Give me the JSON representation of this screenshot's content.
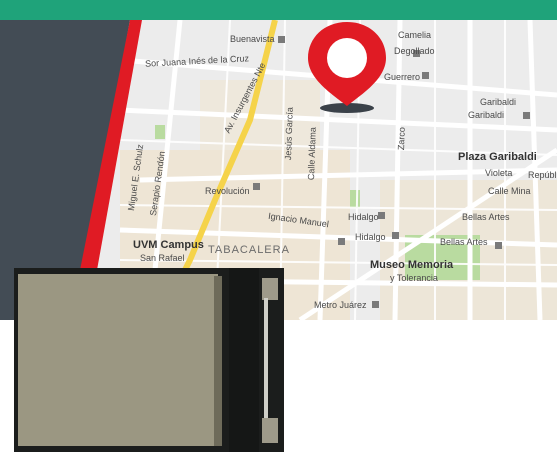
{
  "colors": {
    "top_bar": "#1fa37a",
    "dark_panel": "#434c55",
    "red_stripe": "#e01b24",
    "pin": "#e01b24",
    "map_bg": "#ececec"
  },
  "map": {
    "labels": [
      {
        "id": "buenavista",
        "text": "Buenavista",
        "cls": ""
      },
      {
        "id": "camelia",
        "text": "Camelia",
        "cls": ""
      },
      {
        "id": "degollado",
        "text": "Degollado",
        "cls": ""
      },
      {
        "id": "guerrero",
        "text": "Guerrero",
        "cls": ""
      },
      {
        "id": "sor-juana",
        "text": "Sor Juana Inés de la Cruz",
        "cls": ""
      },
      {
        "id": "av-insurgentes",
        "text": "Av. Insurgentes Nte",
        "cls": ""
      },
      {
        "id": "jesus-garcia",
        "text": "Jesús García",
        "cls": ""
      },
      {
        "id": "calle-aldama",
        "text": "Calle Aldama",
        "cls": ""
      },
      {
        "id": "zarco",
        "text": "Zarco",
        "cls": ""
      },
      {
        "id": "garibaldi-1",
        "text": "Garibaldi",
        "cls": ""
      },
      {
        "id": "garibaldi-2",
        "text": "Garibaldi",
        "cls": ""
      },
      {
        "id": "plaza-garibaldi",
        "text": "Plaza Garibaldi",
        "cls": "big"
      },
      {
        "id": "violeta",
        "text": "Violeta",
        "cls": ""
      },
      {
        "id": "republica",
        "text": "Repúbl",
        "cls": ""
      },
      {
        "id": "calle-mina",
        "text": "Calle Mina",
        "cls": ""
      },
      {
        "id": "revolucion",
        "text": "Revolución",
        "cls": ""
      },
      {
        "id": "ignacio-manuel",
        "text": "Ignacio Manuel",
        "cls": ""
      },
      {
        "id": "hidalgo-1",
        "text": "Hidalgo",
        "cls": ""
      },
      {
        "id": "hidalgo-2",
        "text": "Hidalgo",
        "cls": ""
      },
      {
        "id": "bellas-artes-1",
        "text": "Bellas Artes",
        "cls": ""
      },
      {
        "id": "bellas-artes-2",
        "text": "Bellas Artes",
        "cls": ""
      },
      {
        "id": "uvm-campus",
        "text": "UVM Campus",
        "cls": "big"
      },
      {
        "id": "san-rafael",
        "text": "San Rafael",
        "cls": ""
      },
      {
        "id": "tabacalera",
        "text": "TABACALERA",
        "cls": "area"
      },
      {
        "id": "museo-memoria",
        "text": "Museo Memoria",
        "cls": "big"
      },
      {
        "id": "y-tolerancia",
        "text": "y Tolerancia",
        "cls": ""
      },
      {
        "id": "metro-juarez",
        "text": "Metro Juárez",
        "cls": ""
      },
      {
        "id": "miguel-e",
        "text": "Miguel E. Schulz",
        "cls": ""
      },
      {
        "id": "serapio",
        "text": "Serapio Rendón",
        "cls": ""
      }
    ]
  }
}
